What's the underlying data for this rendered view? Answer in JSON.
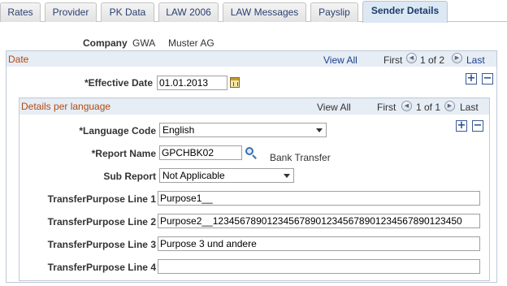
{
  "tabs": [
    {
      "label": "Rates"
    },
    {
      "label": "Provider"
    },
    {
      "label": "PK Data"
    },
    {
      "label": "LAW 2006"
    },
    {
      "label": "LAW Messages"
    },
    {
      "label": "Payslip"
    },
    {
      "label": "Sender Details"
    }
  ],
  "active_tab": "Sender Details",
  "company": {
    "label": "Company",
    "code": "GWA",
    "name": "Muster AG"
  },
  "date_section": {
    "title": "Date",
    "view_all": "View All",
    "first": "First",
    "range": "1 of 2",
    "last": "Last",
    "effective_date_label": "*Effective Date",
    "effective_date_value": "01.01.2013"
  },
  "language_section": {
    "title": "Details per language",
    "view_all": "View All",
    "first": "First",
    "range": "1 of 1",
    "last": "Last",
    "language_code_label": "*Language Code",
    "language_code_value": "English",
    "report_name_label": "*Report Name",
    "report_name_value": "GPCHBK02",
    "report_description": "Bank Transfer",
    "sub_report_label": "Sub Report",
    "sub_report_value": "Not Applicable",
    "purpose_lines": [
      {
        "label": "TransferPurpose Line 1",
        "value": "Purpose1__"
      },
      {
        "label": "TransferPurpose Line 2",
        "value": "Purpose2__1234567890123456789012345678901234567890123450"
      },
      {
        "label": "TransferPurpose Line 3",
        "value": "Purpose 3 und andere"
      },
      {
        "label": "TransferPurpose Line 4",
        "value": ""
      }
    ]
  },
  "icons": {
    "add": "plus-icon",
    "delete": "minus-icon",
    "calendar": "calendar-icon",
    "lookup": "magnifier-icon",
    "prev": "arrow-left-icon",
    "next": "arrow-right-icon"
  },
  "colors": {
    "section_title": "#b04a10",
    "header_bg": "#e6edf5",
    "link": "#1d3f8a",
    "active_tab_bg": "#dce8f4"
  }
}
